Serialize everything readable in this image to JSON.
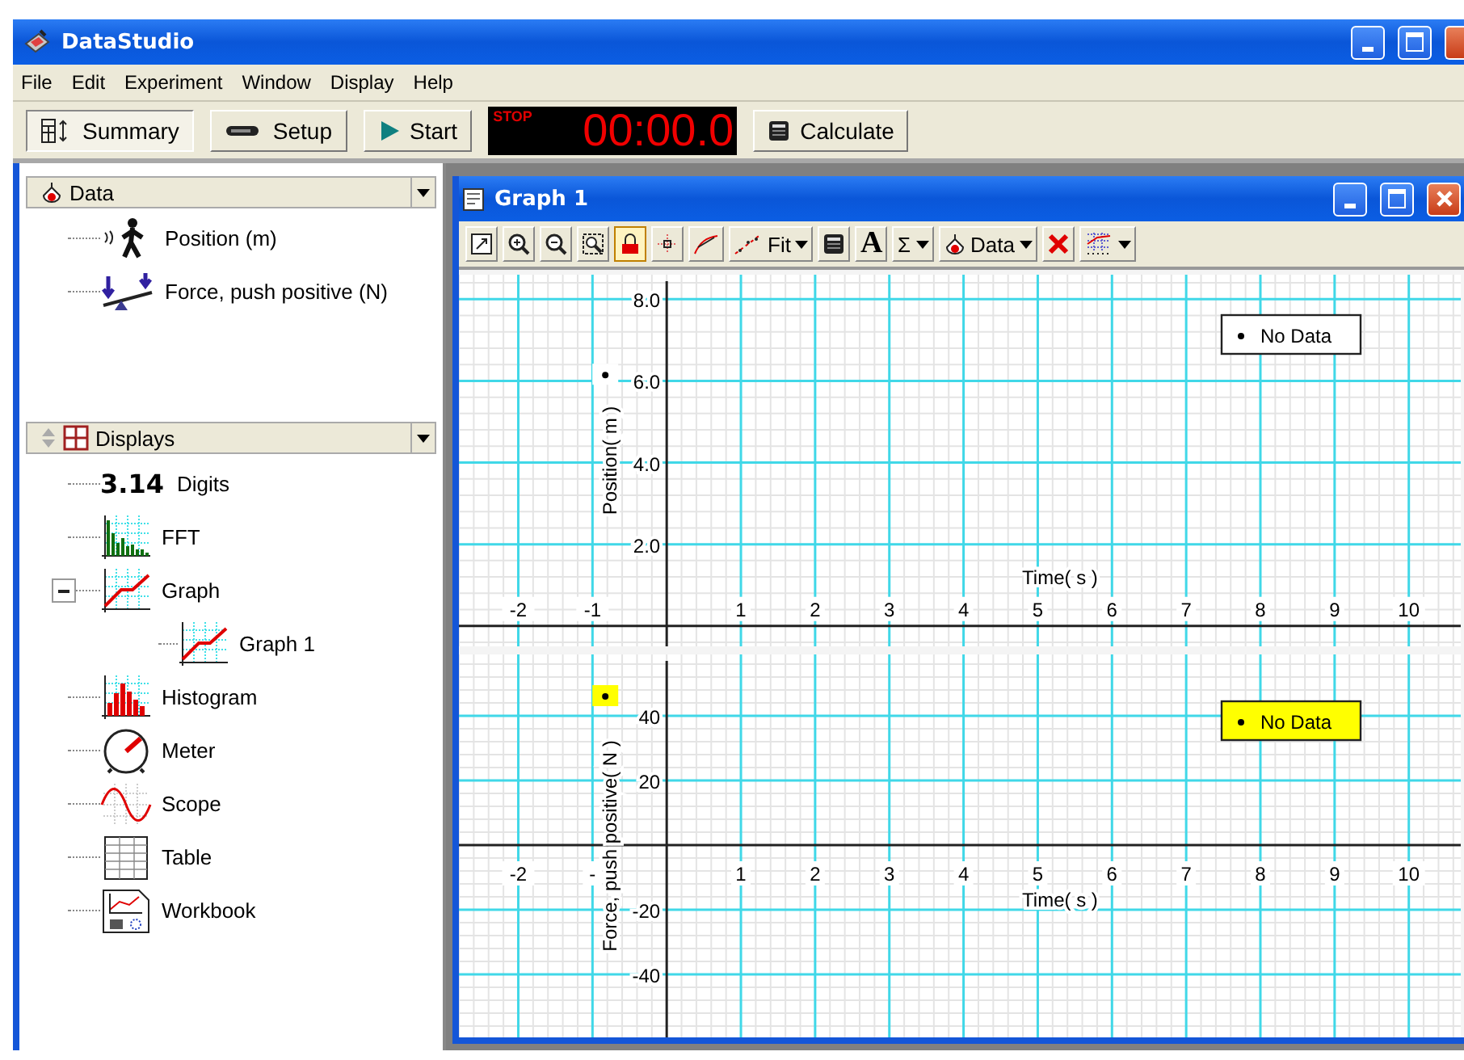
{
  "window": {
    "title": "DataStudio"
  },
  "menu": [
    "File",
    "Edit",
    "Experiment",
    "Window",
    "Display",
    "Help"
  ],
  "toolbar": {
    "buttons": [
      {
        "label": "Summary",
        "kind": "summary",
        "pressed": true
      },
      {
        "label": "Setup",
        "kind": "setup",
        "pressed": false
      },
      {
        "label": "Start",
        "kind": "start",
        "pressed": false
      }
    ],
    "timer": {
      "status": "STOP",
      "time": "00:00.0"
    },
    "calculate": {
      "label": "Calculate"
    }
  },
  "data_panel": {
    "title": "Data",
    "items": [
      {
        "label": "Position (m)",
        "kind": "motion"
      },
      {
        "label": "Force, push positive (N)",
        "kind": "force"
      }
    ]
  },
  "displays_panel": {
    "title": "Displays",
    "items": [
      {
        "label": "Digits",
        "kind": "digits",
        "glyph": "3.14"
      },
      {
        "label": "FFT",
        "kind": "fft"
      },
      {
        "label": "Graph",
        "kind": "graph",
        "expanded": true,
        "children": [
          {
            "label": "Graph 1",
            "kind": "graph"
          }
        ]
      },
      {
        "label": "Histogram",
        "kind": "histogram"
      },
      {
        "label": "Meter",
        "kind": "meter"
      },
      {
        "label": "Scope",
        "kind": "scope"
      },
      {
        "label": "Table",
        "kind": "table"
      },
      {
        "label": "Workbook",
        "kind": "workbook"
      }
    ]
  },
  "graph_window": {
    "title": "Graph 1",
    "tools": [
      {
        "kind": "scale",
        "pressed": false,
        "dropdown": false
      },
      {
        "kind": "zoom-in",
        "pressed": false,
        "dropdown": false
      },
      {
        "kind": "zoom-out",
        "pressed": false,
        "dropdown": false
      },
      {
        "kind": "zoom-select",
        "pressed": false,
        "dropdown": false
      },
      {
        "kind": "lock",
        "pressed": true,
        "dropdown": false
      },
      {
        "kind": "smart-tool",
        "pressed": false,
        "dropdown": false
      },
      {
        "kind": "slope",
        "pressed": false,
        "dropdown": false
      },
      {
        "kind": "fit",
        "label": "Fit",
        "pressed": false,
        "dropdown": true
      },
      {
        "kind": "calculator",
        "pressed": false,
        "dropdown": false
      },
      {
        "kind": "text",
        "label": "A",
        "pressed": false,
        "dropdown": false
      },
      {
        "kind": "sum",
        "label": "Σ",
        "pressed": false,
        "dropdown": true
      },
      {
        "kind": "data",
        "label": "Data",
        "pressed": false,
        "dropdown": true
      },
      {
        "kind": "delete",
        "pressed": false,
        "dropdown": false
      },
      {
        "kind": "settings",
        "pressed": false,
        "dropdown": true
      }
    ],
    "graphs": [
      {
        "selected": false,
        "chart_data": {
          "type": "scatter",
          "xlabel": "Time( s )",
          "ylabel": "Position( m )",
          "grid": true,
          "categories": [
            "-2",
            "-1",
            "1",
            "2",
            "3",
            "4",
            "5",
            "6",
            "7",
            "8",
            "9",
            "10"
          ],
          "ylim": [
            -0.5,
            8.6
          ],
          "yticks": [
            {
              "value": 2,
              "label": "2.0"
            },
            {
              "value": 4,
              "label": "4.0"
            },
            {
              "value": 6,
              "label": "6.0"
            },
            {
              "value": 8,
              "label": "8.0"
            }
          ],
          "series": [
            {
              "name": "No Data",
              "color": "#000000",
              "values": [
                null,
                null,
                null,
                null,
                null,
                null,
                null,
                null,
                null,
                null,
                null,
                null
              ]
            }
          ]
        }
      },
      {
        "selected": true,
        "chart_data": {
          "type": "scatter",
          "xlabel": "Time( s )",
          "ylabel": "Force, push positive( N )",
          "grid": true,
          "categories": [
            "-2",
            "-",
            "1",
            "2",
            "3",
            "4",
            "5",
            "6",
            "7",
            "8",
            "9",
            "10"
          ],
          "ylim": [
            -59.5,
            59
          ],
          "yticks": [
            40,
            20,
            -20,
            -40
          ],
          "series": [
            {
              "name": "No Data",
              "color": "#000000",
              "values": [
                null,
                null,
                null,
                null,
                null,
                null,
                null,
                null,
                null,
                null,
                null,
                null
              ]
            }
          ]
        }
      }
    ]
  }
}
